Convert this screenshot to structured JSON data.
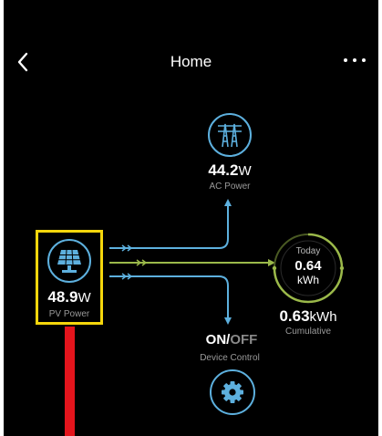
{
  "header": {
    "title": "Home",
    "back_icon": "chevron-left-icon",
    "more_icon": "more-horizontal-icon"
  },
  "ac_node": {
    "icon": "transmission-tower-icon",
    "value": "44.2",
    "unit": "W",
    "label": "AC Power"
  },
  "pv_node": {
    "icon": "solar-panel-icon",
    "value": "48.9",
    "unit": "W",
    "label": "PV Power"
  },
  "today_node": {
    "label": "Today",
    "value": "0.64",
    "unit": "kWh"
  },
  "cumulative_node": {
    "value": "0.63",
    "unit": "kWh",
    "label": "Cumulative"
  },
  "device_control": {
    "on_text": "ON",
    "separator": "/",
    "off_text": "OFF",
    "label": "Device Control",
    "icon": "gear-icon"
  },
  "colors": {
    "background": "#000000",
    "accent_blue": "#5db0de",
    "accent_green": "#9bb94a",
    "highlight_yellow": "#f5d60c",
    "marker_red": "#e4141c"
  }
}
